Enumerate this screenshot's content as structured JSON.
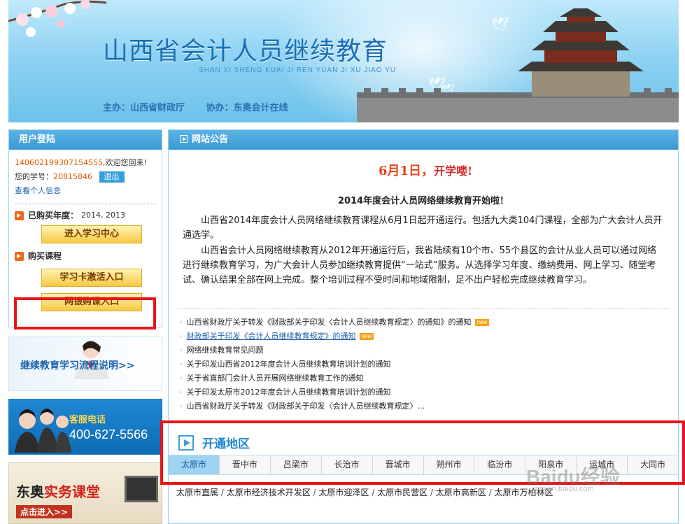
{
  "banner": {
    "title": "山西省会计人员继续教育",
    "pinyin": "SHAN XI SHENG KUAI JI REN YUAN JI XU JIAO YU",
    "host": "主办：山西省财政厅",
    "co_host": "协办：东奥会计在线"
  },
  "login": {
    "title": "用户登陆",
    "user_id": "140602199307154555",
    "welcome": ",欢迎您回来!",
    "student_no_label": "您的学号：",
    "student_no": "20815846",
    "logout": "退出",
    "profile_link": "查看个人信息",
    "purchased_label": "已购买年度：",
    "purchased_years": "2014, 2013",
    "study_center": "进入学习中心",
    "buy_label": "购买课程",
    "card_activate": "学习卡激活入口",
    "bank_buy": "网银购课入口"
  },
  "promos": {
    "flow": "继续教育学习流程说明>>",
    "service_label": "客服电话",
    "service_tel": "400-627-5566",
    "brand_a": "东奥",
    "brand_b": "实务课堂",
    "enter": "点击进入>>"
  },
  "notice": {
    "title": "网站公告",
    "june_badge": "6月1日，",
    "june_badge2": "开学喽!",
    "headline": "2014年度会计人员网络继续教育开始啦！",
    "para1": "山西省2014年度会计人员网络继续教育课程从6月1日起开通运行。包括九大类104门课程，全部为广大会计人员开通选学。",
    "para2": "山西省会计人员网络继续教育从2012年开通运行后，我省陆续有10个市、55个县区的会计从业人员可以通过网络进行继续教育学习，为广大会计人员参加继续教育提供“一站式”服务。从选择学习年度、缴纳费用、网上学习、随堂考试、确认结果全部在网上完成。整个培训过程不受时间和地域限制，足不出户轻松完成继续教育学习。",
    "new_tag": "new",
    "news": [
      "山西省财政厅关于转发《财政部关于印发〈会计人员继续教育规定〉的通知》的通知",
      "财政部关于印发《会计人员继续教育规定》的通知",
      "网络继续教育常见问题",
      "关于印发山西省2012年度会计人员继续教育培训计划的通知",
      "关于省直部门会计人员开展网络继续教育工作的通知",
      "关于印发太原市2012年度会计人员继续教育培训计划的通知",
      "山西省财政厅关于转发《财政部关于印发〈会计人员继续教育规定〉..."
    ]
  },
  "regions": {
    "title": "开通地区",
    "tabs": [
      "太原市",
      "晋中市",
      "吕梁市",
      "长治市",
      "晋城市",
      "朔州市",
      "临汾市",
      "阳泉市",
      "运城市",
      "大同市"
    ],
    "districts": [
      "太原市直属",
      "太原市经济技术开发区",
      "太原市迎泽区",
      "太原市民营区",
      "太原市高新区",
      "太原市万柏林区"
    ]
  },
  "watermark": {
    "logo": "Baidu经验",
    "url": "jingyan.baidu.com"
  }
}
